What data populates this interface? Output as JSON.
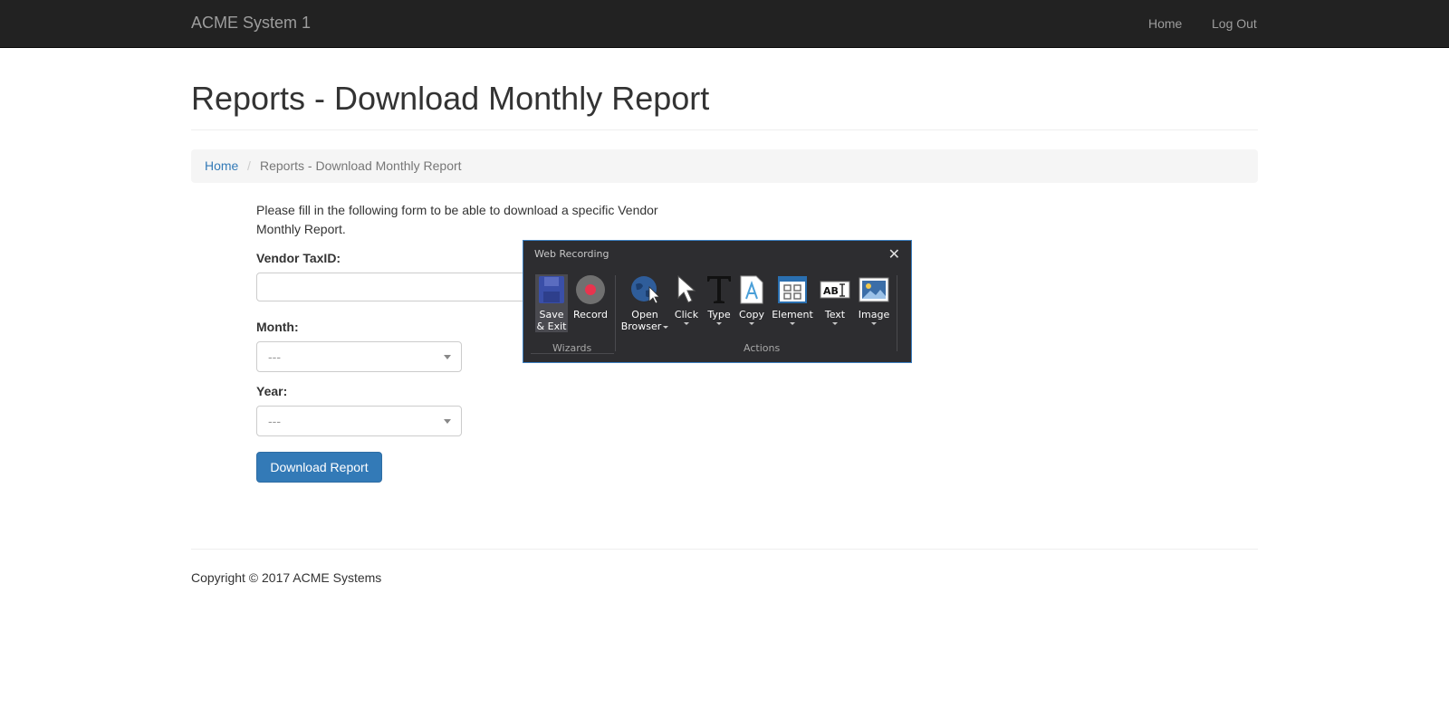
{
  "navbar": {
    "brand": "ACME System 1",
    "links": [
      "Home",
      "Log Out"
    ]
  },
  "page": {
    "title": "Reports - Download Monthly Report"
  },
  "breadcrumb": {
    "home": "Home",
    "separator": "/",
    "current": "Reports - Download Monthly Report"
  },
  "form": {
    "intro": "Please fill in the following form to be able to download a specific Vendor Monthly Report.",
    "vendor_label": "Vendor TaxID:",
    "vendor_value": "",
    "month_label": "Month:",
    "month_value": "---",
    "year_label": "Year:",
    "year_value": "---",
    "submit_label": "Download Report"
  },
  "footer": {
    "copyright": "Copyright © 2017 ACME Systems"
  },
  "recorder": {
    "title": "Web Recording",
    "tools": {
      "save": [
        "Save",
        "& Exit"
      ],
      "record": "Record",
      "open_browser": [
        "Open",
        "Browser"
      ],
      "click": "Click",
      "type": "Type",
      "copy": "Copy",
      "element": "Element",
      "text": "Text",
      "image": "Image"
    },
    "groups": {
      "wizards": "Wizards",
      "actions": "Actions"
    },
    "icons": [
      "save-icon",
      "record-icon",
      "globe-icon",
      "cursor-icon",
      "type-icon",
      "copy-icon",
      "element-icon",
      "text-icon",
      "image-icon"
    ]
  },
  "colors": {
    "navbar_bg": "#222222",
    "link": "#337ab7",
    "primary_button": "#337ab7",
    "recorder_bg": "#2d2d30",
    "record_dot": "#e8344e"
  }
}
